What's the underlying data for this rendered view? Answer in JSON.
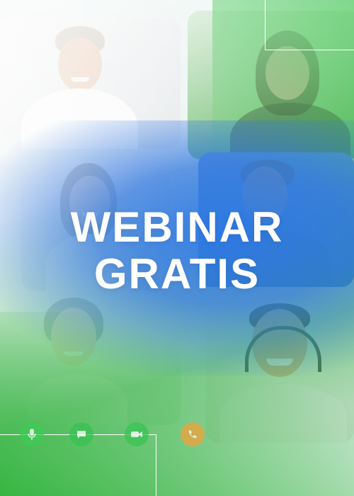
{
  "headline": {
    "line1": "WEBINAR",
    "line2": "GRATIS"
  },
  "colors": {
    "green": "#2fbf3f",
    "blue": "#2f74d8",
    "text": "#ffffff"
  },
  "participants": [
    "participant-1",
    "participant-2",
    "participant-3",
    "participant-4",
    "participant-5",
    "participant-6"
  ],
  "call_controls": [
    "mic-icon",
    "chat-icon",
    "camera-icon",
    "phone-icon"
  ]
}
